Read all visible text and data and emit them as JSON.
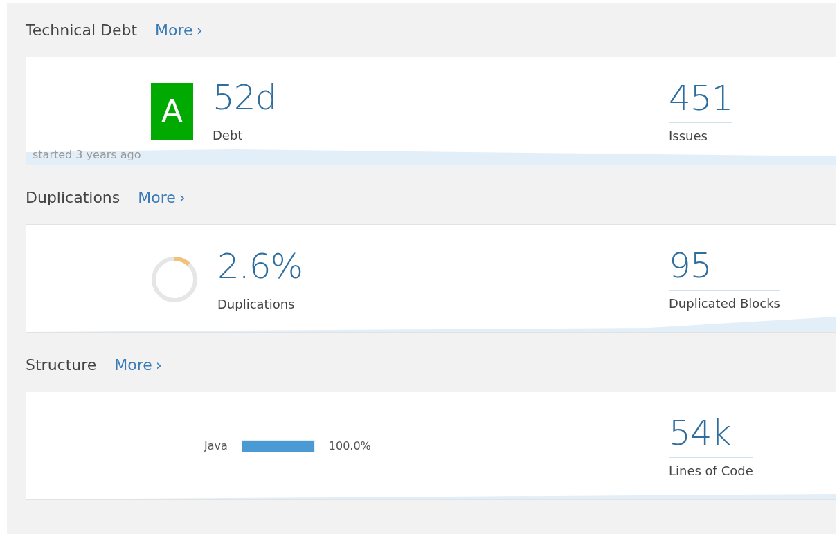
{
  "sections": [
    {
      "kind": "debt",
      "title": "Technical Debt",
      "more": "More",
      "more_icon": "›",
      "rating": {
        "label": "A",
        "color": "#00aa00"
      },
      "metrics": [
        {
          "value": "52d",
          "label": "Debt"
        },
        {
          "value": "451",
          "label": "Issues"
        }
      ],
      "note": "started 3 years ago"
    },
    {
      "kind": "duplications",
      "title": "Duplications",
      "more": "More",
      "more_icon": "›",
      "donut": {
        "level": 0.12
      },
      "metrics": [
        {
          "value": "2.6%",
          "label": "Duplications"
        },
        {
          "value": "95",
          "label": "Duplicated Blocks"
        }
      ]
    },
    {
      "kind": "structure",
      "title": "Structure",
      "more": "More",
      "more_icon": "›",
      "languages": [
        {
          "name": "Java",
          "level": 1.0,
          "share": "100.0%"
        }
      ],
      "metrics": [
        {
          "value": "54k",
          "label": "Lines of Code"
        }
      ]
    }
  ]
}
